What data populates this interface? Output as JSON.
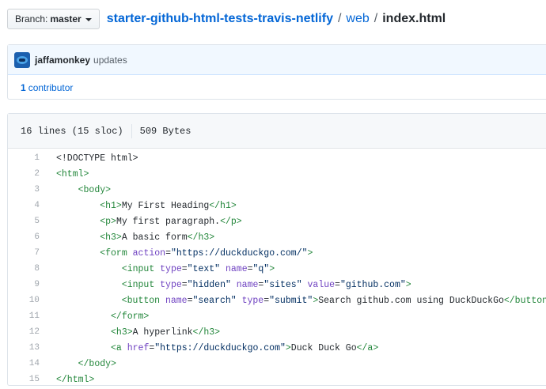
{
  "branch": {
    "prefix": "Branch:",
    "name": "master"
  },
  "breadcrumb": {
    "repo": "starter-github-html-tests-travis-netlify",
    "dir": "web",
    "file": "index.html",
    "sep": "/"
  },
  "commit": {
    "author": "jaffamonkey",
    "message": "updates"
  },
  "contributors": {
    "count": "1",
    "label": "contributor"
  },
  "file_info": {
    "lines": "16 lines (15 sloc)",
    "size": "509 Bytes"
  },
  "code_lines": [
    {
      "n": "1",
      "indent": "",
      "parts": [
        [
          "t",
          "<!DOCTYPE html>"
        ]
      ]
    },
    {
      "n": "2",
      "indent": "",
      "parts": [
        [
          "g",
          "<html>"
        ]
      ]
    },
    {
      "n": "3",
      "indent": "    ",
      "parts": [
        [
          "g",
          "<body>"
        ]
      ]
    },
    {
      "n": "4",
      "indent": "        ",
      "parts": [
        [
          "g",
          "<h1>"
        ],
        [
          "t",
          "My First Heading"
        ],
        [
          "g",
          "</h1>"
        ]
      ]
    },
    {
      "n": "5",
      "indent": "        ",
      "parts": [
        [
          "g",
          "<p>"
        ],
        [
          "t",
          "My first paragraph."
        ],
        [
          "g",
          "</p>"
        ]
      ]
    },
    {
      "n": "6",
      "indent": "        ",
      "parts": [
        [
          "g",
          "<h3>"
        ],
        [
          "t",
          "A basic form"
        ],
        [
          "g",
          "</h3>"
        ]
      ]
    },
    {
      "n": "7",
      "indent": "        ",
      "parts": [
        [
          "g",
          "<form "
        ],
        [
          "a",
          "action"
        ],
        [
          "t",
          "="
        ],
        [
          "s",
          "\"https://duckduckgo.com/\""
        ],
        [
          "g",
          ">"
        ]
      ]
    },
    {
      "n": "8",
      "indent": "            ",
      "parts": [
        [
          "g",
          "<input "
        ],
        [
          "a",
          "type"
        ],
        [
          "t",
          "="
        ],
        [
          "s",
          "\"text\""
        ],
        [
          "t",
          " "
        ],
        [
          "a",
          "name"
        ],
        [
          "t",
          "="
        ],
        [
          "s",
          "\"q\""
        ],
        [
          "g",
          ">"
        ]
      ]
    },
    {
      "n": "9",
      "indent": "            ",
      "parts": [
        [
          "g",
          "<input "
        ],
        [
          "a",
          "type"
        ],
        [
          "t",
          "="
        ],
        [
          "s",
          "\"hidden\""
        ],
        [
          "t",
          " "
        ],
        [
          "a",
          "name"
        ],
        [
          "t",
          "="
        ],
        [
          "s",
          "\"sites\""
        ],
        [
          "t",
          " "
        ],
        [
          "a",
          "value"
        ],
        [
          "t",
          "="
        ],
        [
          "s",
          "\"github.com\""
        ],
        [
          "g",
          ">"
        ]
      ]
    },
    {
      "n": "10",
      "indent": "            ",
      "parts": [
        [
          "g",
          "<button "
        ],
        [
          "a",
          "name"
        ],
        [
          "t",
          "="
        ],
        [
          "s",
          "\"search\""
        ],
        [
          "t",
          " "
        ],
        [
          "a",
          "type"
        ],
        [
          "t",
          "="
        ],
        [
          "s",
          "\"submit\""
        ],
        [
          "g",
          ">"
        ],
        [
          "t",
          "Search github.com using DuckDuckGo"
        ],
        [
          "g",
          "</button>"
        ]
      ]
    },
    {
      "n": "11",
      "indent": "          ",
      "parts": [
        [
          "g",
          "</form>"
        ]
      ]
    },
    {
      "n": "12",
      "indent": "          ",
      "parts": [
        [
          "g",
          "<h3>"
        ],
        [
          "t",
          "A hyperlink"
        ],
        [
          "g",
          "</h3>"
        ]
      ]
    },
    {
      "n": "13",
      "indent": "          ",
      "parts": [
        [
          "g",
          "<a "
        ],
        [
          "a",
          "href"
        ],
        [
          "t",
          "="
        ],
        [
          "s",
          "\"https://duckduckgo.com\""
        ],
        [
          "g",
          ">"
        ],
        [
          "t",
          "Duck Duck Go"
        ],
        [
          "g",
          "</a>"
        ]
      ]
    },
    {
      "n": "14",
      "indent": "    ",
      "parts": [
        [
          "g",
          "</body>"
        ]
      ]
    },
    {
      "n": "15",
      "indent": "",
      "parts": [
        [
          "g",
          "</html>"
        ]
      ]
    }
  ]
}
